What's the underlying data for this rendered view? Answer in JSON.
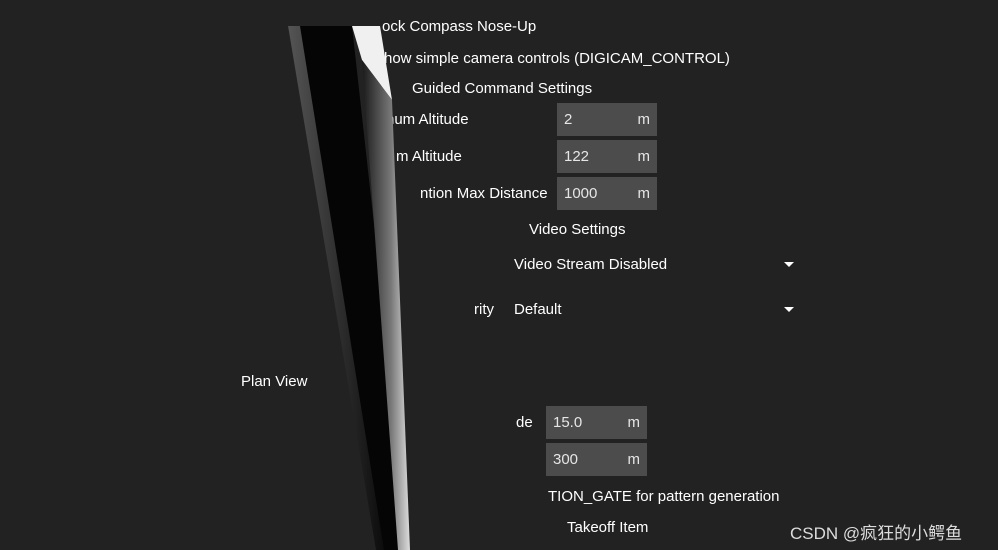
{
  "general": {
    "lock_compass_label": "ock Compass Nose-Up",
    "simple_camera_label": "how simple camera controls (DIGICAM_CONTROL)"
  },
  "guided": {
    "heading": "Guided Command Settings",
    "min_altitude": {
      "label": "num Altitude",
      "value": "2",
      "unit": "m"
    },
    "max_altitude": {
      "label": "m Altitude",
      "value": "122",
      "unit": "m"
    },
    "max_distance": {
      "label": "ntion Max Distance",
      "value": "1000",
      "unit": "m"
    }
  },
  "video": {
    "heading": "Video Settings",
    "source": {
      "value": "Video Stream Disabled"
    },
    "priority": {
      "label": "rity",
      "value": "Default"
    }
  },
  "plan_view": {
    "label": "Plan View",
    "altitude": {
      "label": "de",
      "value": "15.0",
      "unit": "m"
    },
    "distance": {
      "value": "300",
      "unit": "m"
    },
    "gate_label": "TION_GATE for pattern generation",
    "takeoff_label": "Takeoff Item"
  },
  "watermark": "CSDN @疯狂的小鳄鱼",
  "colors": {
    "background": "#222222",
    "field": "#4c4c4c"
  }
}
